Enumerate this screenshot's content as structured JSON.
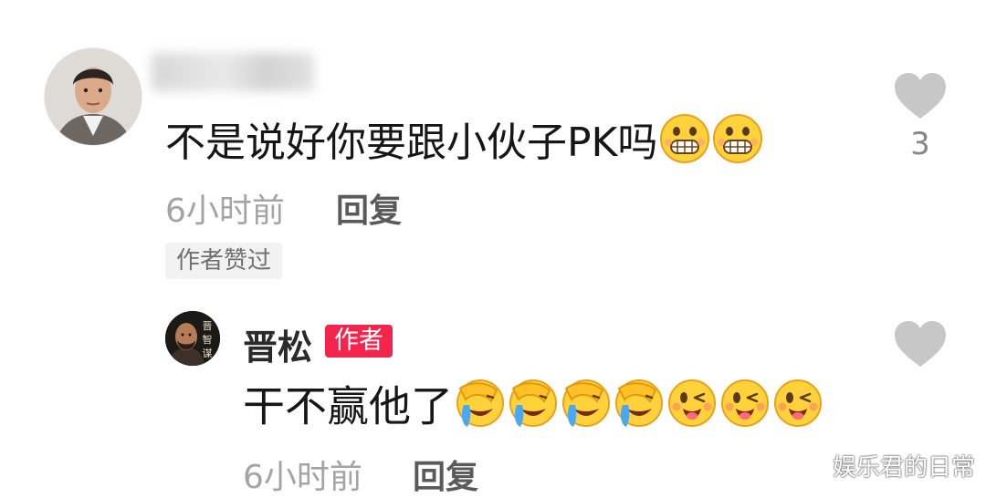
{
  "comment": {
    "text": "不是说好你要跟小伙子PK吗",
    "emoji_icons": [
      "grin-emoji-icon",
      "grin-emoji-icon"
    ],
    "time": "6小时前",
    "reply_label": "回复",
    "liked_tag": "作者赞过",
    "like_count": "3"
  },
  "reply": {
    "name": "晋松",
    "badge": "作者",
    "text": "干不赢他了",
    "emoji_icons": [
      "facepalm-laugh-emoji-icon",
      "facepalm-laugh-emoji-icon",
      "facepalm-laugh-emoji-icon",
      "facepalm-laugh-emoji-icon",
      "wink-tongue-emoji-icon",
      "wink-tongue-emoji-icon",
      "wink-tongue-emoji-icon"
    ],
    "time": "6小时前",
    "reply_label": "回复"
  },
  "watermark": "娱乐君的日常",
  "colors": {
    "author_badge": "#f4254c",
    "heart": "#c7c7c7",
    "meta_text": "#a4a4a4"
  }
}
